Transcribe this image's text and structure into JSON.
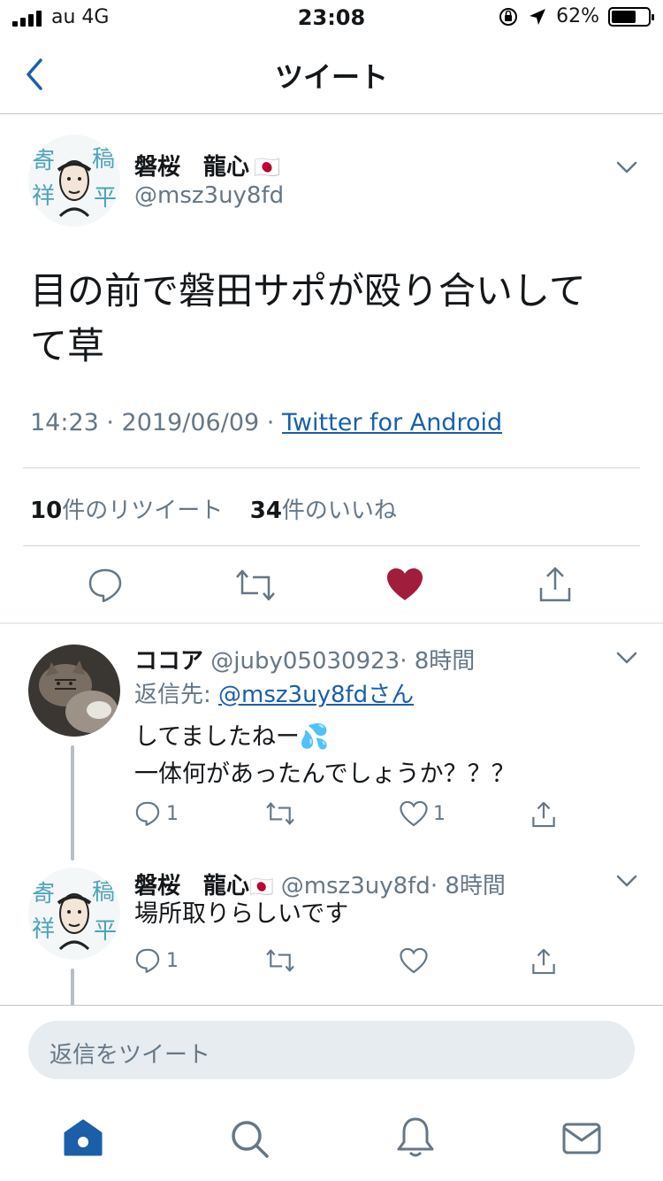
{
  "status_bar": {
    "carrier": "au  4G",
    "time": "23:08",
    "battery": "62%"
  },
  "header": {
    "title": "ツイート"
  },
  "tweet": {
    "author_name": "磐桜　龍心",
    "author_flag": "🇯🇵",
    "handle": "@msz3uy8fd",
    "text_line1": "目の前で磐田サポが殴り合いして",
    "text_line2": "て草",
    "timestamp": "14:23 · 2019/06/09 · ",
    "source": "Twitter for Android",
    "retweets_count": "10",
    "retweets_label": "件のリツイート",
    "likes_count": "34",
    "likes_label": "件のいいね",
    "liked_color": "#a01d3c"
  },
  "replies": [
    {
      "name": "ココア",
      "handle": "@juby05030923",
      "time": "· 8時間",
      "reply_to_label": "返信先: ",
      "reply_to_handle": "@msz3uy8fdさん",
      "line1": "してましたねー💦",
      "line2": "一体何があったんでしょうか？？？",
      "reply_count": "1",
      "like_count": "1"
    },
    {
      "name": "磐桜　龍心",
      "flag": "🇯🇵",
      "handle": "@msz3uy8fd",
      "time": "· 8時間",
      "line1": "場所取りらしいです",
      "reply_count": "1",
      "like_count": ""
    }
  ],
  "compose": {
    "placeholder": "返信をツイート"
  },
  "accent_color": "#1b5fa9",
  "tabbar": [
    "home-icon",
    "search-icon",
    "notifications-icon",
    "messages-icon"
  ]
}
